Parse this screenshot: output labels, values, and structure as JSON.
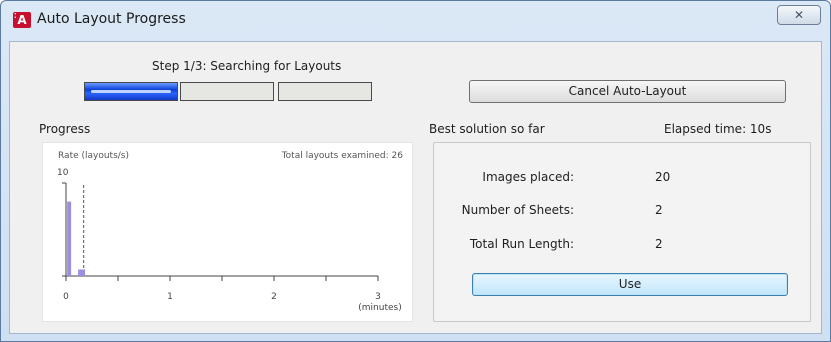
{
  "window": {
    "title": "Auto Layout Progress",
    "icon": "autolayout-app-icon",
    "icon_letter": "A",
    "close_glyph": "✕"
  },
  "progress_header": {
    "step_label": "Step 1/3: Searching for Layouts",
    "steps_total": 3,
    "steps_active": 1,
    "cancel_label": "Cancel Auto-Layout"
  },
  "progress_section": {
    "label": "Progress"
  },
  "best_section": {
    "label": "Best solution so far",
    "elapsed": "Elapsed time: 10s"
  },
  "results": {
    "images_label": "Images placed:",
    "images_value": "20",
    "sheets_label": "Number of Sheets:",
    "sheets_value": "2",
    "runlength_label": "Total Run Length:",
    "runlength_value": "2",
    "use_label": "Use"
  },
  "colors": {
    "accent_blue": "#1d4fe8",
    "bar_purple": "#9d8fe0",
    "window_frame": "#cfe0f2"
  },
  "chart_data": {
    "type": "bar",
    "title": "Rate (layouts/s)",
    "annotation": "Total layouts examined: 26",
    "ylabel": "Rate (layouts/s)",
    "xlabel": "(minutes)",
    "xlim": [
      0,
      3
    ],
    "ylim": [
      0,
      10
    ],
    "y_tick_labels": [
      "10"
    ],
    "x_tick_labels": [
      "0",
      "1",
      "2",
      "3"
    ],
    "x_minor_ticks": 0.5,
    "series": [
      {
        "x": [
          0.03,
          0.15
        ],
        "values": [
          8,
          0.7
        ]
      }
    ],
    "current_time_marker": 0.17,
    "grid": false
  }
}
